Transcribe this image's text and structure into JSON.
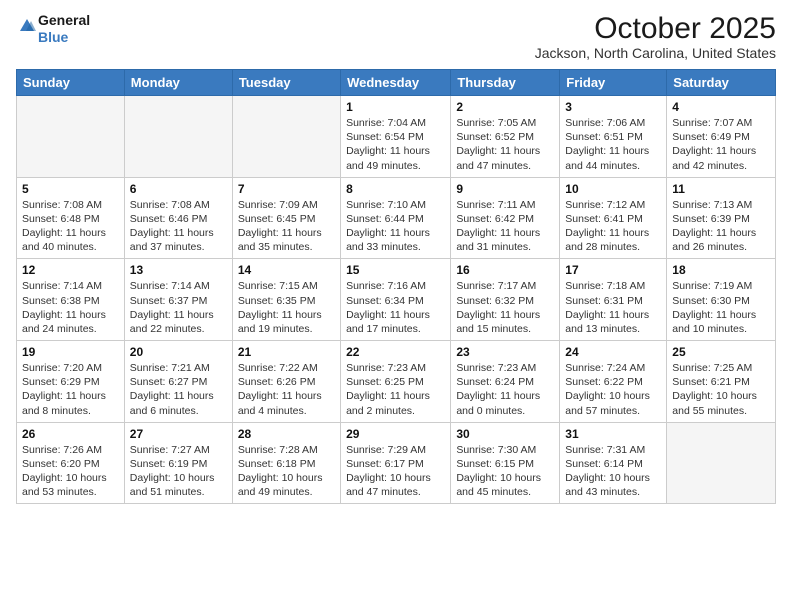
{
  "logo": {
    "line1": "General",
    "line2": "Blue"
  },
  "title": "October 2025",
  "subtitle": "Jackson, North Carolina, United States",
  "headers": [
    "Sunday",
    "Monday",
    "Tuesday",
    "Wednesday",
    "Thursday",
    "Friday",
    "Saturday"
  ],
  "weeks": [
    [
      {
        "day": "",
        "info": ""
      },
      {
        "day": "",
        "info": ""
      },
      {
        "day": "",
        "info": ""
      },
      {
        "day": "1",
        "info": "Sunrise: 7:04 AM\nSunset: 6:54 PM\nDaylight: 11 hours\nand 49 minutes."
      },
      {
        "day": "2",
        "info": "Sunrise: 7:05 AM\nSunset: 6:52 PM\nDaylight: 11 hours\nand 47 minutes."
      },
      {
        "day": "3",
        "info": "Sunrise: 7:06 AM\nSunset: 6:51 PM\nDaylight: 11 hours\nand 44 minutes."
      },
      {
        "day": "4",
        "info": "Sunrise: 7:07 AM\nSunset: 6:49 PM\nDaylight: 11 hours\nand 42 minutes."
      }
    ],
    [
      {
        "day": "5",
        "info": "Sunrise: 7:08 AM\nSunset: 6:48 PM\nDaylight: 11 hours\nand 40 minutes."
      },
      {
        "day": "6",
        "info": "Sunrise: 7:08 AM\nSunset: 6:46 PM\nDaylight: 11 hours\nand 37 minutes."
      },
      {
        "day": "7",
        "info": "Sunrise: 7:09 AM\nSunset: 6:45 PM\nDaylight: 11 hours\nand 35 minutes."
      },
      {
        "day": "8",
        "info": "Sunrise: 7:10 AM\nSunset: 6:44 PM\nDaylight: 11 hours\nand 33 minutes."
      },
      {
        "day": "9",
        "info": "Sunrise: 7:11 AM\nSunset: 6:42 PM\nDaylight: 11 hours\nand 31 minutes."
      },
      {
        "day": "10",
        "info": "Sunrise: 7:12 AM\nSunset: 6:41 PM\nDaylight: 11 hours\nand 28 minutes."
      },
      {
        "day": "11",
        "info": "Sunrise: 7:13 AM\nSunset: 6:39 PM\nDaylight: 11 hours\nand 26 minutes."
      }
    ],
    [
      {
        "day": "12",
        "info": "Sunrise: 7:14 AM\nSunset: 6:38 PM\nDaylight: 11 hours\nand 24 minutes."
      },
      {
        "day": "13",
        "info": "Sunrise: 7:14 AM\nSunset: 6:37 PM\nDaylight: 11 hours\nand 22 minutes."
      },
      {
        "day": "14",
        "info": "Sunrise: 7:15 AM\nSunset: 6:35 PM\nDaylight: 11 hours\nand 19 minutes."
      },
      {
        "day": "15",
        "info": "Sunrise: 7:16 AM\nSunset: 6:34 PM\nDaylight: 11 hours\nand 17 minutes."
      },
      {
        "day": "16",
        "info": "Sunrise: 7:17 AM\nSunset: 6:32 PM\nDaylight: 11 hours\nand 15 minutes."
      },
      {
        "day": "17",
        "info": "Sunrise: 7:18 AM\nSunset: 6:31 PM\nDaylight: 11 hours\nand 13 minutes."
      },
      {
        "day": "18",
        "info": "Sunrise: 7:19 AM\nSunset: 6:30 PM\nDaylight: 11 hours\nand 10 minutes."
      }
    ],
    [
      {
        "day": "19",
        "info": "Sunrise: 7:20 AM\nSunset: 6:29 PM\nDaylight: 11 hours\nand 8 minutes."
      },
      {
        "day": "20",
        "info": "Sunrise: 7:21 AM\nSunset: 6:27 PM\nDaylight: 11 hours\nand 6 minutes."
      },
      {
        "day": "21",
        "info": "Sunrise: 7:22 AM\nSunset: 6:26 PM\nDaylight: 11 hours\nand 4 minutes."
      },
      {
        "day": "22",
        "info": "Sunrise: 7:23 AM\nSunset: 6:25 PM\nDaylight: 11 hours\nand 2 minutes."
      },
      {
        "day": "23",
        "info": "Sunrise: 7:23 AM\nSunset: 6:24 PM\nDaylight: 11 hours\nand 0 minutes."
      },
      {
        "day": "24",
        "info": "Sunrise: 7:24 AM\nSunset: 6:22 PM\nDaylight: 10 hours\nand 57 minutes."
      },
      {
        "day": "25",
        "info": "Sunrise: 7:25 AM\nSunset: 6:21 PM\nDaylight: 10 hours\nand 55 minutes."
      }
    ],
    [
      {
        "day": "26",
        "info": "Sunrise: 7:26 AM\nSunset: 6:20 PM\nDaylight: 10 hours\nand 53 minutes."
      },
      {
        "day": "27",
        "info": "Sunrise: 7:27 AM\nSunset: 6:19 PM\nDaylight: 10 hours\nand 51 minutes."
      },
      {
        "day": "28",
        "info": "Sunrise: 7:28 AM\nSunset: 6:18 PM\nDaylight: 10 hours\nand 49 minutes."
      },
      {
        "day": "29",
        "info": "Sunrise: 7:29 AM\nSunset: 6:17 PM\nDaylight: 10 hours\nand 47 minutes."
      },
      {
        "day": "30",
        "info": "Sunrise: 7:30 AM\nSunset: 6:15 PM\nDaylight: 10 hours\nand 45 minutes."
      },
      {
        "day": "31",
        "info": "Sunrise: 7:31 AM\nSunset: 6:14 PM\nDaylight: 10 hours\nand 43 minutes."
      },
      {
        "day": "",
        "info": ""
      }
    ]
  ]
}
